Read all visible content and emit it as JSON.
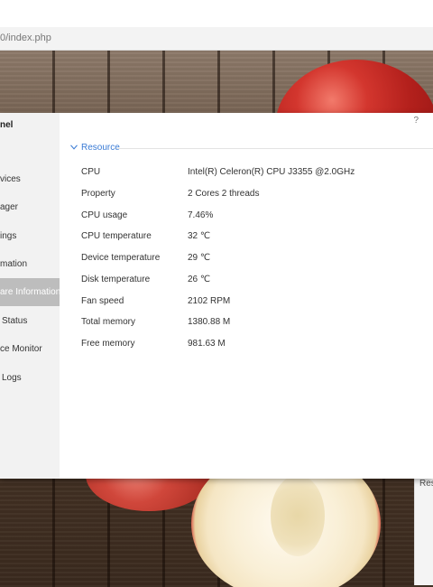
{
  "browser": {
    "url": "0/index.php"
  },
  "sidebar": {
    "title": "nel",
    "items": [
      {
        "label": "vices",
        "active": false
      },
      {
        "label": "ager",
        "active": false
      },
      {
        "label": "ings",
        "active": false
      },
      {
        "label": "mation",
        "active": false
      },
      {
        "label": "are Information",
        "active": true
      },
      {
        "label": "Status",
        "active": false
      },
      {
        "label": "ce Monitor",
        "active": false
      },
      {
        "label": "Logs",
        "active": false
      }
    ]
  },
  "panel": {
    "help": "?",
    "section": "Resource",
    "rows": [
      {
        "label": "CPU",
        "value": "Intel(R) Celeron(R) CPU J3355 @2.0GHz"
      },
      {
        "label": "Property",
        "value": "2 Cores 2 threads"
      },
      {
        "label": "CPU usage",
        "value": "7.46%"
      },
      {
        "label": "CPU temperature",
        "value": "32 ℃"
      },
      {
        "label": "Device temperature",
        "value": "29 ℃"
      },
      {
        "label": "Disk temperature",
        "value": "26 ℃"
      },
      {
        "label": "Fan speed",
        "value": "2102 RPM"
      },
      {
        "label": "Total memory",
        "value": "1380.88 M"
      },
      {
        "label": "Free memory",
        "value": "981.63 M"
      }
    ]
  },
  "right_panel": {
    "label": "Res"
  },
  "colors": {
    "accent": "#3a7bd5",
    "active_bg": "#bdbdbd"
  }
}
